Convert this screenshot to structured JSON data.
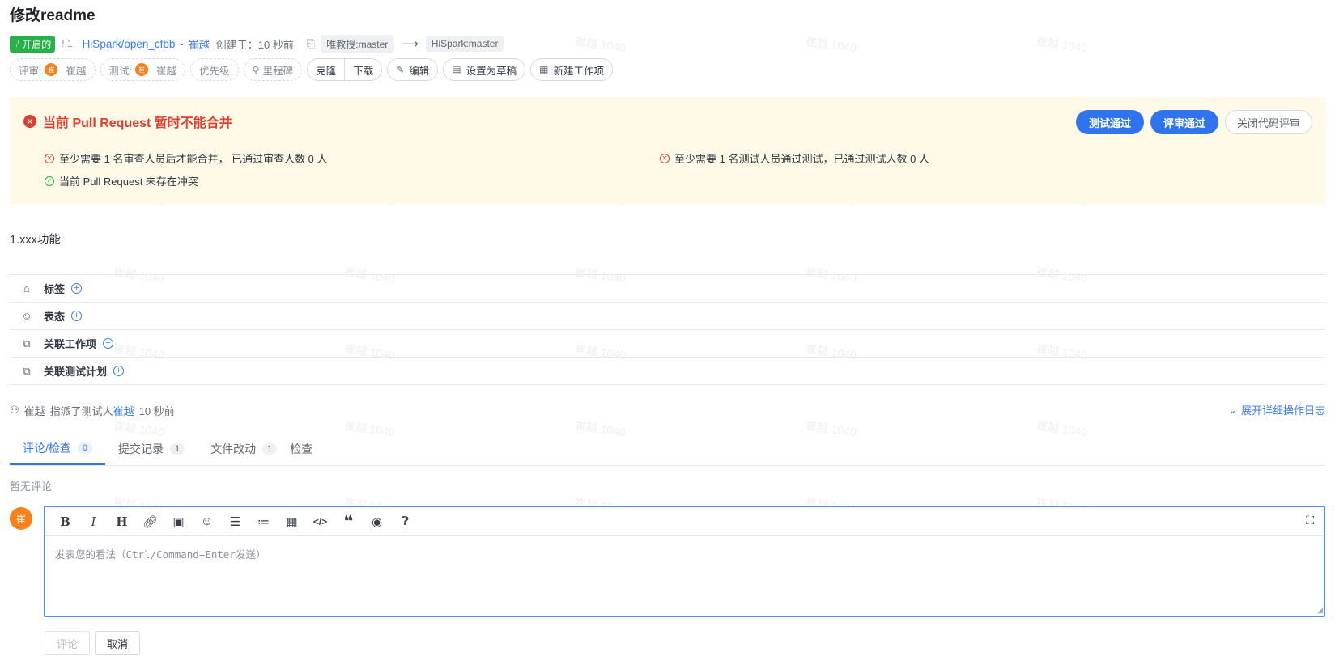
{
  "title": "修改readme",
  "meta": {
    "state": "开启的",
    "pr_number": "! 1",
    "repo": "HiSpark/open_cfbb",
    "separator": "-",
    "author": "崔越",
    "created": "创建于：10 秒前",
    "source_branch": "唯教授:master",
    "target_branch": "HiSpark:master"
  },
  "chips": {
    "review_label": "评审:",
    "review_avatar": "崔",
    "review_user": "崔越",
    "test_label": "测试:",
    "test_avatar": "崔",
    "test_user": "崔越",
    "priority": "优先级",
    "milestone": "里程碑",
    "clone": "克隆",
    "download": "下载",
    "edit": "编辑",
    "set_draft": "设置为草稿",
    "new_work_item": "新建工作项"
  },
  "banner": {
    "title": "当前 Pull Request 暂时不能合并",
    "btn_test_pass": "测试通过",
    "btn_review_pass": "评审通过",
    "btn_close_review": "关闭代码评审",
    "cond_review": "至少需要 1 名审查人员后才能合并， 已通过审查人数 0 人",
    "cond_test": "至少需要 1 名测试人员通过测试，已通过测试人数 0 人",
    "cond_conflict": "当前 Pull Request 未存在冲突"
  },
  "description": "1.xxx功能",
  "attributes": [
    {
      "label": "标签"
    },
    {
      "label": "表态"
    },
    {
      "label": "关联工作项"
    },
    {
      "label": "关联测试计划"
    }
  ],
  "activity": {
    "actor": "崔越",
    "action": "指派了测试人",
    "target": "崔越",
    "time": "10 秒前",
    "expand": "展开详细操作日志"
  },
  "tabs": [
    {
      "label": "评论/检查",
      "count": "0"
    },
    {
      "label": "提交记录",
      "count": "1"
    },
    {
      "label": "文件改动",
      "count": "1"
    },
    {
      "label": "检查",
      "count": ""
    }
  ],
  "no_comment": "暂无评论",
  "editor": {
    "avatar": "崔",
    "placeholder": "发表您的看法（Ctrl/Command+Enter发送）"
  },
  "actions": {
    "comment": "评论",
    "cancel": "取消"
  },
  "watermark": "崔越 1040",
  "colors": {
    "accent": "#2f74ee",
    "open_badge": "#27b148",
    "error": "#e23c2e",
    "banner_bg": "#fff9e8",
    "avatar": "#f7821b"
  }
}
